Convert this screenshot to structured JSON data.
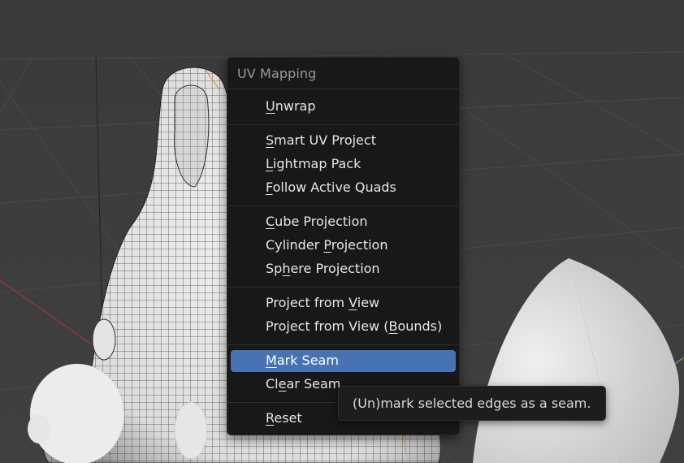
{
  "colors": {
    "viewport_bg": "#3d3d3d",
    "menu_bg": "#181818",
    "highlight": "#4772b3",
    "mesh_fill": "#e9e9e9",
    "wire": "#2b2b2b"
  },
  "menu": {
    "title": "UV Mapping",
    "groups": [
      [
        {
          "id": "unwrap",
          "pre": "",
          "key": "U",
          "post": "nwrap"
        }
      ],
      [
        {
          "id": "smart-uv-project",
          "pre": "",
          "key": "S",
          "post": "mart UV Project"
        },
        {
          "id": "lightmap-pack",
          "pre": "",
          "key": "L",
          "post": "ightmap Pack"
        },
        {
          "id": "follow-active-quads",
          "pre": "",
          "key": "F",
          "post": "ollow Active Quads"
        }
      ],
      [
        {
          "id": "cube-projection",
          "pre": "",
          "key": "C",
          "post": "ube Projection"
        },
        {
          "id": "cylinder-projection",
          "pre": "Cylinder ",
          "key": "P",
          "post": "rojection"
        },
        {
          "id": "sphere-projection",
          "pre": "Sp",
          "key": "h",
          "post": "ere Projection"
        }
      ],
      [
        {
          "id": "project-from-view",
          "pre": "Project from ",
          "key": "V",
          "post": "iew"
        },
        {
          "id": "project-from-view-bounds",
          "pre": "Project from View (",
          "key": "B",
          "post": "ounds)"
        }
      ],
      [
        {
          "id": "mark-seam",
          "pre": "",
          "key": "M",
          "post": "ark Seam",
          "highlighted": true
        },
        {
          "id": "clear-seam",
          "pre": "Cl",
          "key": "e",
          "post": "ar Seam"
        }
      ],
      [
        {
          "id": "reset",
          "pre": "",
          "key": "R",
          "post": "eset"
        }
      ]
    ]
  },
  "tooltip": {
    "text": "(Un)mark selected edges as a seam."
  }
}
